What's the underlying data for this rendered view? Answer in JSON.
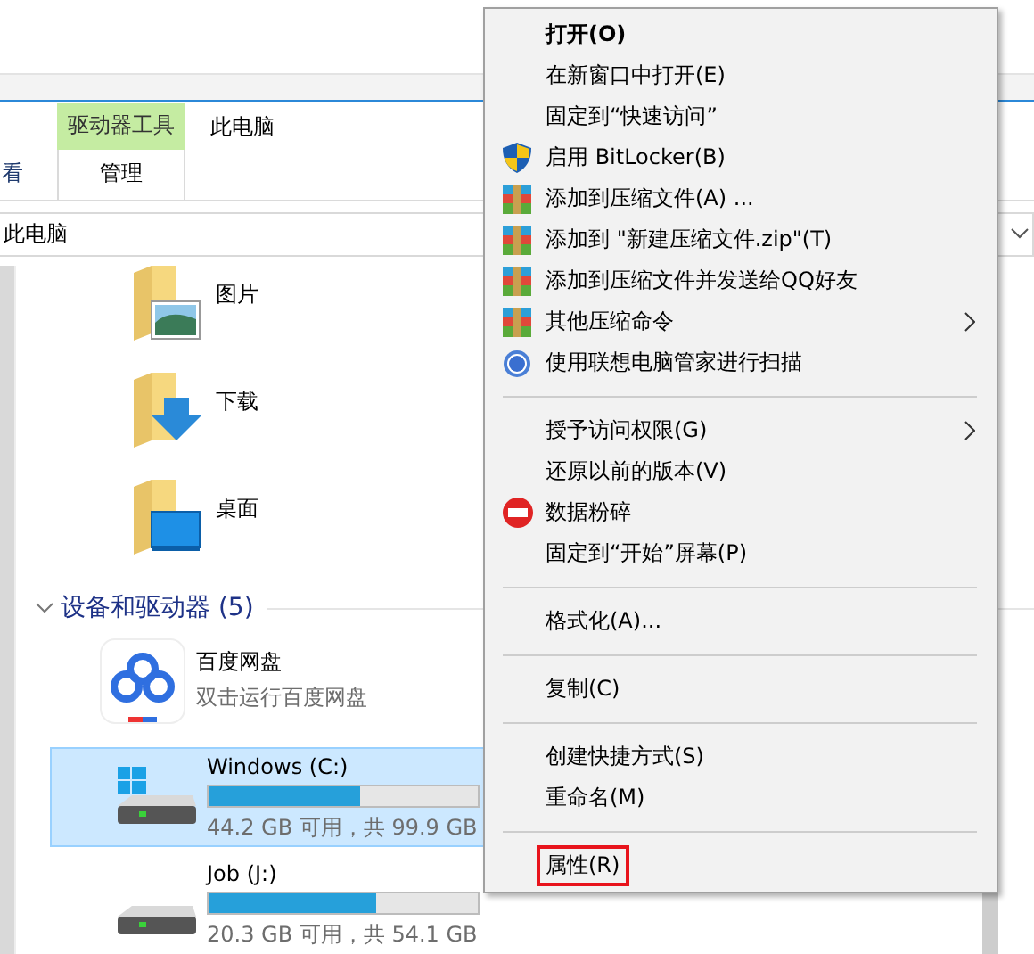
{
  "ribbon": {
    "tabs": [
      {
        "label": "看",
        "selected": false
      },
      {
        "label": "管理",
        "selected": true,
        "context_group": "驱动器工具"
      },
      {
        "label": "此电脑",
        "selected": false
      }
    ]
  },
  "address_bar": {
    "path": "此电脑"
  },
  "folders": [
    {
      "name": "图片",
      "kind": "pictures"
    },
    {
      "name": "下载",
      "kind": "downloads"
    },
    {
      "name": "桌面",
      "kind": "desktop"
    }
  ],
  "devices_section": {
    "title": "设备和驱动器 (5)",
    "expanded": true
  },
  "devices": [
    {
      "kind": "app",
      "name": "百度网盘",
      "subtitle": "双击运行百度网盘",
      "selected": false
    },
    {
      "kind": "drive",
      "name": "Windows (C:)",
      "system": true,
      "level": 0.56,
      "reading": "44.2 GB 可用，共 99.9 GB",
      "selected": true
    },
    {
      "kind": "drive",
      "name": "Job (J:)",
      "system": false,
      "level": 0.62,
      "reading": "20.3 GB 可用，共 54.1 GB",
      "selected": false
    }
  ],
  "context_menu": [
    {
      "kind": "plain",
      "label": "打开(O)",
      "default": true
    },
    {
      "kind": "plain",
      "label": "在新窗口中打开(E)"
    },
    {
      "kind": "plain",
      "label": "固定到“快速访问”"
    },
    {
      "kind": "shield",
      "label": "启用 BitLocker(B)"
    },
    {
      "kind": "archive",
      "label": "添加到压缩文件(A) ..."
    },
    {
      "kind": "archive",
      "label": "添加到 \"新建压缩文件.zip\"(T)"
    },
    {
      "kind": "archive",
      "label": "添加到压缩文件并发送给QQ好友"
    },
    {
      "kind": "archive",
      "label": "其他压缩命令",
      "submenu": true
    },
    {
      "kind": "scan",
      "label": "使用联想电脑管家进行扫描"
    },
    {
      "kind": "separator"
    },
    {
      "kind": "plain",
      "label": "授予访问权限(G)",
      "submenu": true
    },
    {
      "kind": "plain",
      "label": "还原以前的版本(V)"
    },
    {
      "kind": "shred",
      "label": "数据粉碎"
    },
    {
      "kind": "plain",
      "label": "固定到“开始”屏幕(P)"
    },
    {
      "kind": "separator"
    },
    {
      "kind": "plain",
      "label": "格式化(A)..."
    },
    {
      "kind": "separator"
    },
    {
      "kind": "plain",
      "label": "复制(C)"
    },
    {
      "kind": "separator"
    },
    {
      "kind": "plain",
      "label": "创建快捷方式(S)"
    },
    {
      "kind": "plain",
      "label": "重命名(M)"
    },
    {
      "kind": "separator"
    },
    {
      "kind": "plain",
      "label": "属性(R)",
      "highlighted": true
    }
  ]
}
